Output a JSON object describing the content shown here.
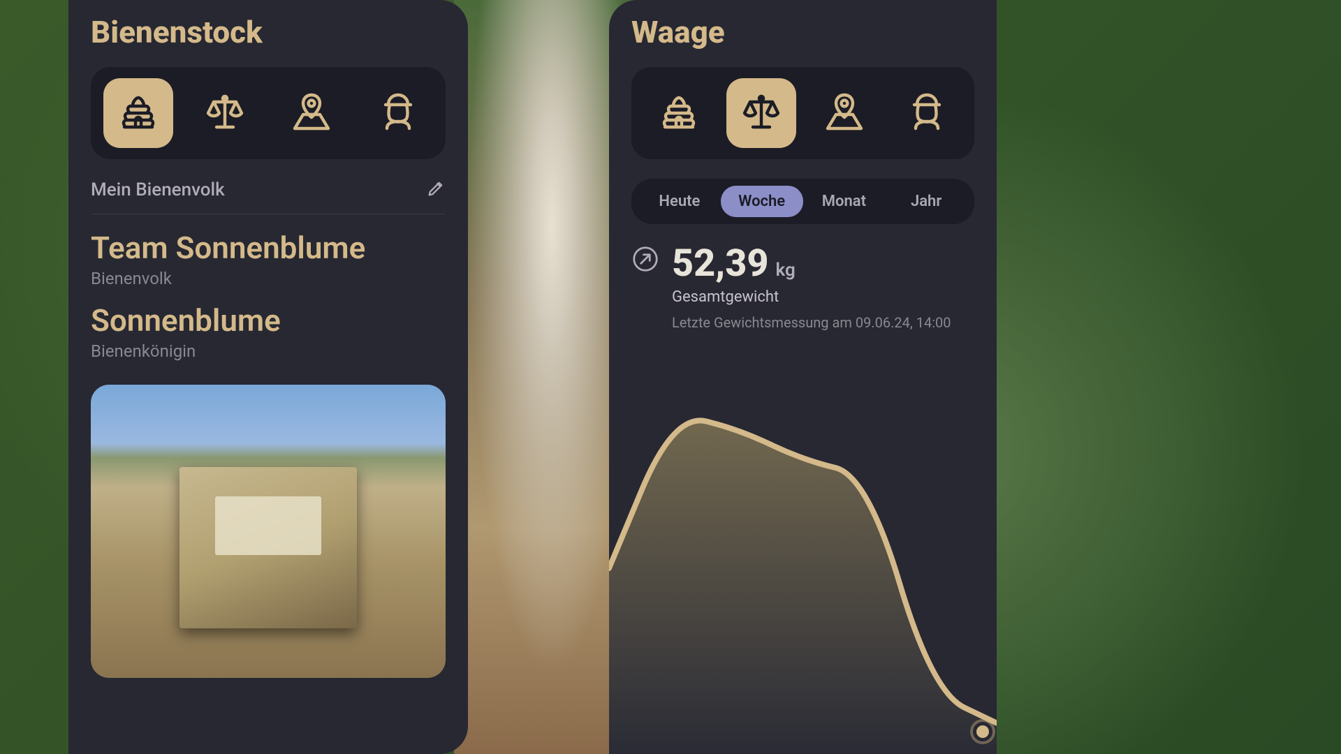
{
  "colors": {
    "accent": "#d4b98a",
    "bg_panel": "#272832",
    "bg_pill": "#1b1c25",
    "segment_active": "#8c8ec8"
  },
  "left_panel": {
    "title": "Bienenstock",
    "tabs": [
      {
        "name": "hive-icon",
        "active": true
      },
      {
        "name": "scale-icon",
        "active": false
      },
      {
        "name": "location-icon",
        "active": false
      },
      {
        "name": "beekeeper-icon",
        "active": false
      }
    ],
    "colony_row_label": "Mein Bienenvolk",
    "team_name": "Team Sonnenblume",
    "team_sublabel": "Bienenvolk",
    "queen_name": "Sonnenblume",
    "queen_sublabel": "Bienenkönigin"
  },
  "right_panel": {
    "title": "Waage",
    "tabs": [
      {
        "name": "hive-icon",
        "active": false
      },
      {
        "name": "scale-icon",
        "active": true
      },
      {
        "name": "location-icon",
        "active": false
      },
      {
        "name": "beekeeper-icon",
        "active": false
      }
    ],
    "segments": [
      {
        "label": "Heute",
        "active": false
      },
      {
        "label": "Woche",
        "active": true
      },
      {
        "label": "Monat",
        "active": false
      },
      {
        "label": "Jahr",
        "active": false
      }
    ],
    "weight_value": "52,39",
    "weight_unit": "kg",
    "weight_caption": "Gesamtgewicht",
    "last_measurement": "Letzte Gewichtsmessung am 09.06.24, 14:00"
  },
  "chart_data": {
    "type": "area",
    "title": "",
    "xlabel": "",
    "ylabel": "kg",
    "ylim": [
      36,
      60
    ],
    "x": [
      0,
      1,
      2,
      3,
      4,
      5,
      6
    ],
    "values": [
      48,
      58,
      57,
      55,
      54,
      40,
      38
    ]
  }
}
